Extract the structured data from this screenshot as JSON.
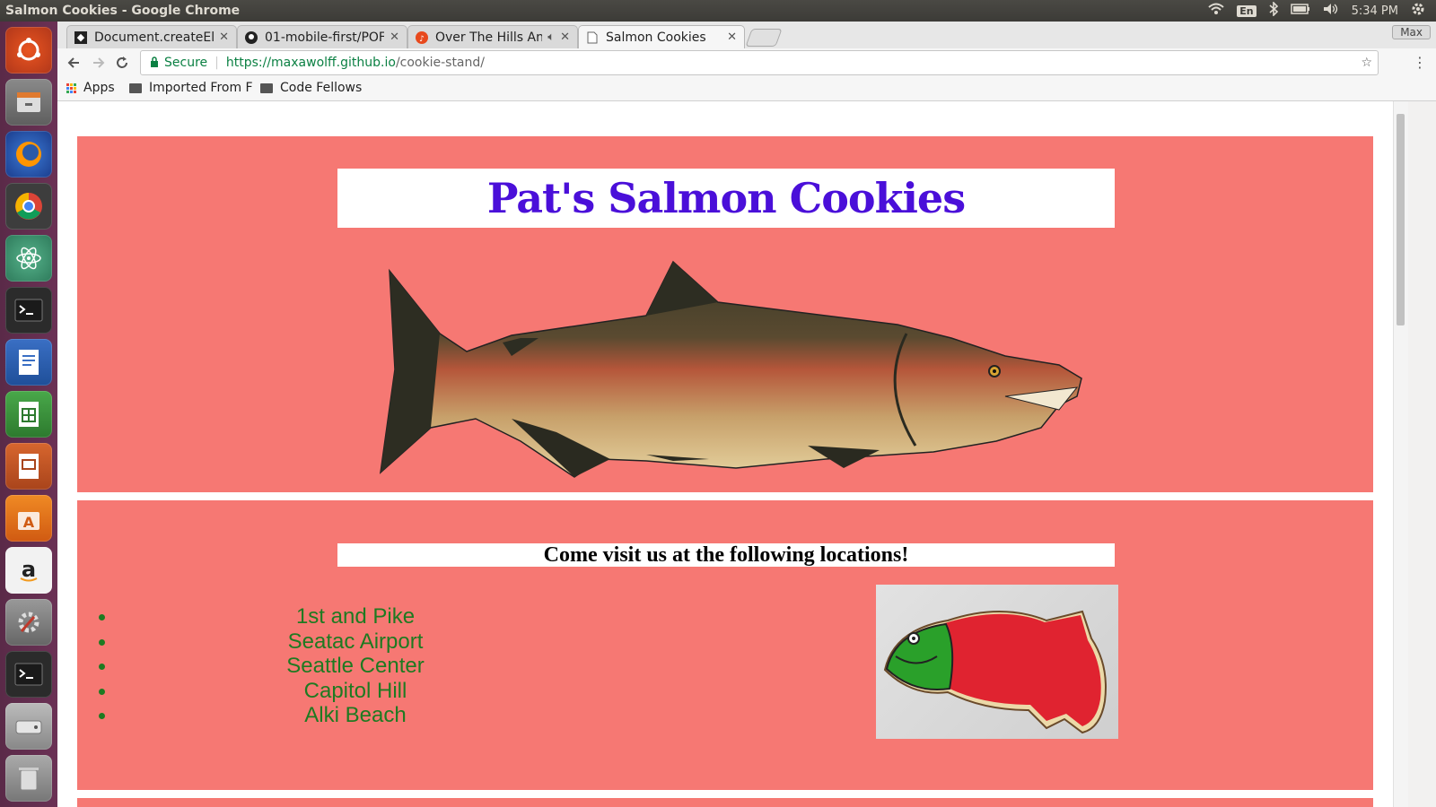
{
  "system": {
    "window_title": "Salmon Cookies - Google Chrome",
    "lang": "En",
    "time": "5:34 PM"
  },
  "browser": {
    "tabs": [
      {
        "label": "Document.createEl",
        "icon": "codepen-icon",
        "active": false
      },
      {
        "label": "01-mobile-first/POF",
        "icon": "github-icon",
        "active": false
      },
      {
        "label": "Over The Hills An",
        "icon": "music-icon",
        "active": false
      },
      {
        "label": "Salmon Cookies",
        "icon": "page-icon",
        "active": true
      }
    ],
    "profile": "Max",
    "secure_label": "Secure",
    "url_host": "https://maxawolff.github.io",
    "url_path": "/cookie-stand/",
    "bookmarks": [
      "Apps",
      "Imported From F",
      "Code Fellows"
    ]
  },
  "page": {
    "title": "Pat's Salmon Cookies",
    "colors": {
      "background": "#f67873",
      "title": "#4a0fd9",
      "locations": "#1e7a21"
    },
    "locations_heading": "Come visit us at the following locations!",
    "locations": [
      "1st and Pike",
      "Seatac Airport",
      "Seattle Center",
      "Capitol Hill",
      "Alki Beach"
    ]
  }
}
